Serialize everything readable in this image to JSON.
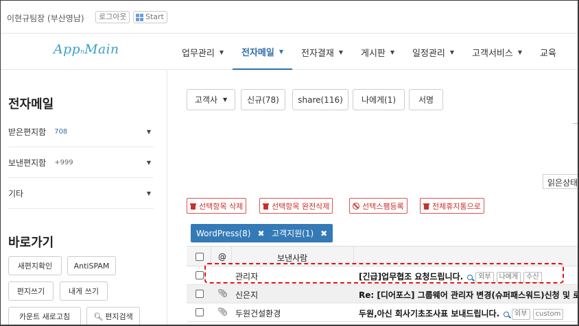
{
  "topbar": {
    "user": "이현규팀장 (부산영남)",
    "logout_label": "로그아웃",
    "start_label": "Start"
  },
  "navbar": {
    "logo": "App",
    "logo_small": "n",
    "logo_tail": "Main",
    "menu": [
      {
        "label": "업무관리"
      },
      {
        "label": "전자메일",
        "active": true
      },
      {
        "label": "전자결재"
      },
      {
        "label": "게시판"
      },
      {
        "label": "일정관리"
      },
      {
        "label": "고객서비스"
      },
      {
        "label": "교육"
      }
    ]
  },
  "sidebar": {
    "title": "전자메일",
    "items": [
      {
        "label": "받은편지함",
        "count": "708"
      },
      {
        "label": "보낸편지함",
        "count": "+999"
      },
      {
        "label": "기타",
        "count": ""
      }
    ],
    "shortcut_title": "바로가기",
    "shortcuts": [
      "새편지확인",
      "AntiSPAM",
      "편지쓰기",
      "내게 쓰기",
      "카운트 새로고침",
      "편지검색"
    ]
  },
  "filters": {
    "customer": "고객사",
    "new": "신규(78)",
    "share": "share(116)",
    "to_me": "나에게(1)",
    "signature": "서명"
  },
  "read_status": "읽은상태",
  "actions": {
    "delete": "선택항목 삭제",
    "delete_permanent": "선택항목 완전삭제",
    "spam": "선택스팸등록",
    "trash": "전체휴지통으로"
  },
  "tags": [
    {
      "label": "WordPress(8)"
    },
    {
      "label": "고객지원(1)"
    }
  ],
  "table": {
    "header": {
      "at": "@",
      "sender": "보낸사람"
    },
    "rows": [
      {
        "sender": "관리자",
        "subject": "[긴급]업무협조 요청드립니다.",
        "badges": [
          "외부",
          "나에게",
          "수신"
        ],
        "attach": false
      },
      {
        "sender": "신은지",
        "subject": "Re: [디어포스] 그룹웨어 관리자 변경(슈퍼패스워드)신청 및 로",
        "badges": [],
        "attach": true
      },
      {
        "sender": "두원건설환경",
        "subject": "두원,아신 회사기초조사표 보내드립니다.",
        "badges": [
          "외부",
          "custom"
        ],
        "attach": true
      }
    ]
  }
}
